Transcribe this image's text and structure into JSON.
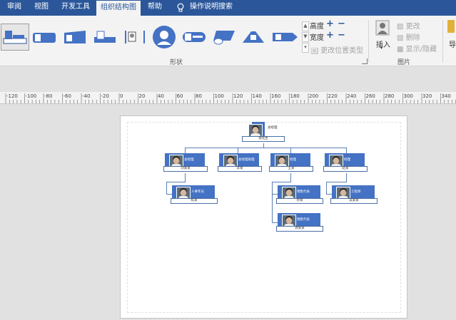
{
  "tabs": [
    {
      "label": "审阅",
      "active": false
    },
    {
      "label": "视图",
      "active": false
    },
    {
      "label": "开发工具",
      "active": false
    },
    {
      "label": "组织结构图",
      "active": true
    },
    {
      "label": "帮助",
      "active": false
    },
    {
      "label": "操作说明搜索",
      "active": false
    }
  ],
  "ribbon": {
    "shapes_group_label": "形状",
    "picture_group_label": "图片",
    "height_label": "高度",
    "width_label": "宽度",
    "change_position_type": "更改位置类型",
    "insert_label": "插入",
    "change_label": "更改",
    "delete_label": "删除",
    "show_hide_label": "显示/隐藏",
    "truncated_label": "导"
  },
  "ruler_ticks": [
    "-120",
    "-100",
    "-80",
    "-60",
    "-40",
    "-20",
    "0",
    "20",
    "40",
    "60",
    "80",
    "100",
    "120",
    "140",
    "160",
    "180",
    "200",
    "220",
    "240",
    "260",
    "280",
    "300",
    "320",
    "340"
  ],
  "org": {
    "root": {
      "title": "总经理",
      "name": "张先生"
    },
    "level2": [
      {
        "title": "总经理",
        "name": "刘某某"
      },
      {
        "title": "总经理助理",
        "name": "李某"
      },
      {
        "title": "经理",
        "name": "王某"
      },
      {
        "title": "经理",
        "name": "赵某"
      }
    ],
    "level3": [
      {
        "title": "人事专员",
        "name": "陈某"
      },
      {
        "title": "销售代表",
        "name": "孙某"
      },
      {
        "title": "销售代表",
        "name": "周某某"
      },
      {
        "title": "工程师",
        "name": "吴某某"
      }
    ]
  },
  "colors": {
    "accent": "#2b579a",
    "shape_fill": "#4472c4"
  }
}
